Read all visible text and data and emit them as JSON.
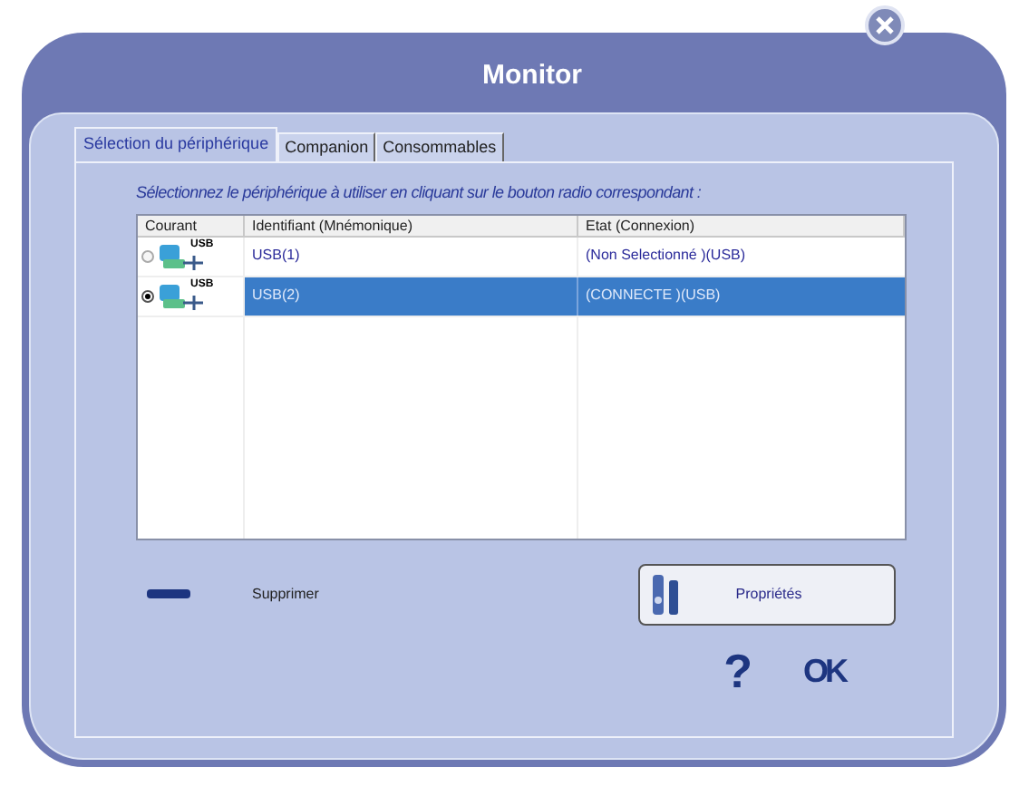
{
  "window": {
    "title": "Monitor"
  },
  "tabs": [
    {
      "label": "Sélection du périphérique",
      "selected": true
    },
    {
      "label": "Companion",
      "selected": false
    },
    {
      "label": "Consommables",
      "selected": false
    }
  ],
  "instruction": "Sélectionnez le périphérique à utiliser en cliquant sur le bouton radio correspondant :",
  "table": {
    "columns": [
      "Courant",
      "Identifiant (Mnémonique)",
      "Etat (Connexion)"
    ],
    "rows": [
      {
        "icon_label": "USB",
        "identifier": "USB(1)",
        "state": "(Non Selectionné )(USB)",
        "selected": false
      },
      {
        "icon_label": "USB",
        "identifier": "USB(2)",
        "state": "(CONNECTE )(USB)",
        "selected": true
      }
    ]
  },
  "delete_label": "Supprimer",
  "properties_button": "Propriétés",
  "help_button": "?",
  "ok_button": "OK"
}
